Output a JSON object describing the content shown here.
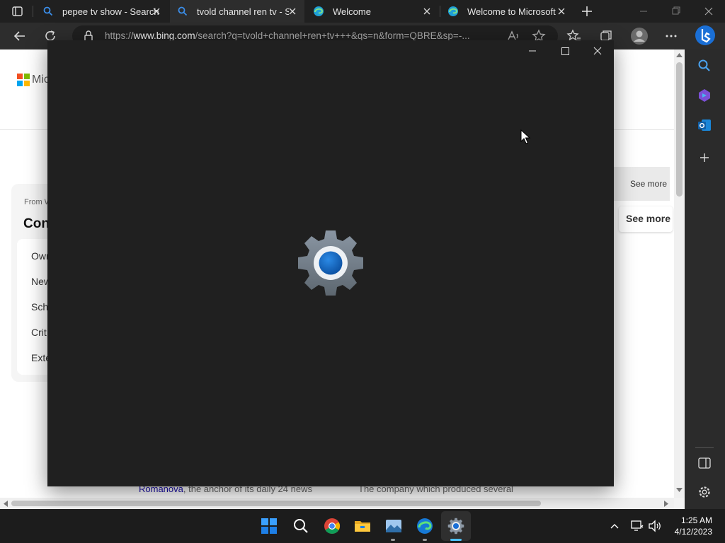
{
  "browser": {
    "tabs": [
      {
        "title": "pepee tv show - Search",
        "icon": "search-icon",
        "active": false
      },
      {
        "title": "tvold channel ren tv - Se",
        "icon": "search-icon",
        "active": true
      },
      {
        "title": "Welcome",
        "icon": "edge-icon",
        "active": false
      },
      {
        "title": "Welcome to Microsoft E",
        "icon": "edge-icon",
        "active": false
      }
    ],
    "url_prefix": "https://",
    "url_domain": "www.bing.com",
    "url_rest": "/search?q=tvold+channel+ren+tv+++&qs=n&form=QBRE&sp=-..."
  },
  "page": {
    "logo_text": "Mic",
    "from_label": "From W",
    "heading": "Con",
    "list_items": [
      "Own",
      "New",
      "Sch",
      "Crit",
      "Exte"
    ],
    "see_more_1": "See more",
    "see_more_2": "See more",
    "bottom_left_link": "Romanova",
    "bottom_left_text": ", the anchor of its daily 24 news",
    "bottom_right_text": "The company which produced several"
  },
  "settings_window": {
    "app_icon": "settings-gear-icon"
  },
  "taskbar": {
    "time": "1:25 AM",
    "date": "4/12/2023",
    "apps": [
      "start-icon",
      "search-icon",
      "chrome-icon",
      "file-explorer-icon",
      "photos-icon",
      "edge-icon",
      "settings-icon"
    ]
  },
  "colors": {
    "accent": "#0067c0",
    "settings_bg": "#202020",
    "tab_bg": "#202020",
    "active_tab_bg": "#2d2d2d"
  }
}
